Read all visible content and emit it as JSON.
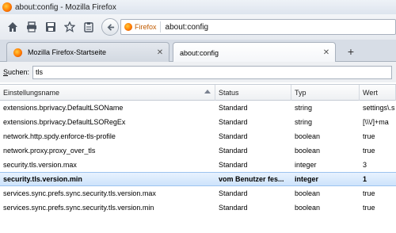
{
  "window": {
    "title": "about:config - Mozilla Firefox"
  },
  "toolbar": {
    "identity_label": "Firefox",
    "url": "about:config",
    "buttons": [
      "home-icon",
      "print-icon",
      "save-icon",
      "bookmark-star-icon",
      "clipboard-icon"
    ]
  },
  "tabs": [
    {
      "label": "Mozilla Firefox-Startseite",
      "active": false
    },
    {
      "label": "about:config",
      "active": true
    }
  ],
  "search": {
    "label_prefix": "S",
    "label_rest": "uchen:",
    "value": "tls"
  },
  "columns": [
    "Einstellungsname",
    "Status",
    "Typ",
    "Wert"
  ],
  "rows": [
    {
      "name": "extensions.bprivacy.DefaultLSOName",
      "status": "Standard",
      "type": "string",
      "value": "settings\\.s"
    },
    {
      "name": "extensions.bprivacy.DefaultLSORegEx",
      "status": "Standard",
      "type": "string",
      "value": "[\\\\\\/]+ma"
    },
    {
      "name": "network.http.spdy.enforce-tls-profile",
      "status": "Standard",
      "type": "boolean",
      "value": "true"
    },
    {
      "name": "network.proxy.proxy_over_tls",
      "status": "Standard",
      "type": "boolean",
      "value": "true"
    },
    {
      "name": "security.tls.version.max",
      "status": "Standard",
      "type": "integer",
      "value": "3"
    },
    {
      "name": "security.tls.version.min",
      "status": "vom Benutzer fes...",
      "type": "integer",
      "value": "1",
      "selected": true
    },
    {
      "name": "services.sync.prefs.sync.security.tls.version.max",
      "status": "Standard",
      "type": "boolean",
      "value": "true"
    },
    {
      "name": "services.sync.prefs.sync.security.tls.version.min",
      "status": "Standard",
      "type": "boolean",
      "value": "true"
    }
  ],
  "colors": {
    "selection": "#cde3fb",
    "identity": "#c15b00"
  }
}
